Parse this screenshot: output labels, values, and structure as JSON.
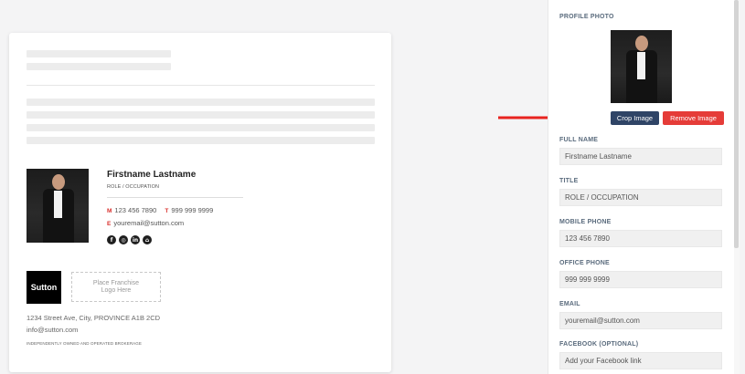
{
  "signature": {
    "name": "Firstname Lastname",
    "role": "ROLE / OCCUPATION",
    "mobile_label": "M",
    "mobile": "123 456 7890",
    "office_label": "T",
    "office": "999 999 9999",
    "email_label": "E",
    "email": "youremail@sutton.com",
    "socials": [
      "facebook-icon",
      "instagram-icon",
      "linkedin-icon",
      "home-icon"
    ],
    "social_glyphs": [
      "f",
      "◎",
      "in",
      "⌂"
    ],
    "logo_text": "Sutton",
    "franchise_line1": "Place Franchise",
    "franchise_line2": "Logo Here",
    "address": "1234 Street Ave, City, PROVINCE A1B 2CD",
    "company_email": "info@sutton.com",
    "disclaimer": "INDEPENDENTLY OWNED AND OPERATED BROKERAGE"
  },
  "panel": {
    "profile_photo_label": "PROFILE PHOTO",
    "crop_button": "Crop Image",
    "remove_button": "Remove Image",
    "fields": [
      {
        "label": "FULL NAME",
        "value": "Firstname Lastname"
      },
      {
        "label": "TITLE",
        "value": "ROLE / OCCUPATION"
      },
      {
        "label": "MOBILE PHONE",
        "value": "123 456 7890"
      },
      {
        "label": "OFFICE PHONE",
        "value": "999 999 9999"
      },
      {
        "label": "EMAIL",
        "value": "youremail@sutton.com"
      },
      {
        "label": "FACEBOOK (OPTIONAL)",
        "placeholder": "Add your Facebook link"
      }
    ]
  },
  "colors": {
    "accent_red": "#e53c38",
    "crop_button": "#2f4466",
    "label": "#5a6b7d"
  }
}
